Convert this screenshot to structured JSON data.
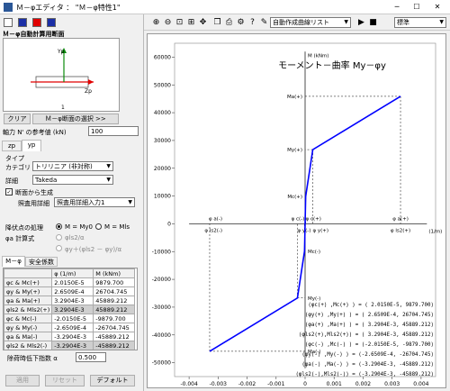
{
  "window": {
    "title": "Ｍ－φエディタ ： \"Ｍ－φ特性1\"",
    "minimize": "─",
    "maximize": "☐",
    "close": "✕"
  },
  "left": {
    "section_title": "Ｍ－φ自動計算用断面",
    "preview": {
      "axis_y": "Yp",
      "axis_z": "Zp",
      "index": "1"
    },
    "clear_button": "クリア",
    "select_section_button": "Ｍ－φ断面の選択 >>",
    "axial_label": "軸力 N' の参考値 (kN)",
    "axial_value": "100",
    "tabs": [
      "zp",
      "yp"
    ],
    "type_label": "タイプ",
    "category_label": "カテゴリ",
    "category_value": "トリリニア (非対称)",
    "detail_label": "詳細",
    "detail_value": "Takeda",
    "generate_label": "断面から生成",
    "checked": "✓",
    "reinforce_label": "照査用詳細",
    "reinforce_value": "照査用詳細入力1",
    "dropping_label": "降伏点の処理",
    "radio1": "M = My0",
    "radio2": "M = Mls",
    "phi_a_label": "φa 計算式",
    "formula1": "φls2/α",
    "formula2": "φy＋(φls2 － φy)/α",
    "table_tabs": [
      "M－φ",
      "安全係数"
    ],
    "table": {
      "headers": [
        "",
        "φ (1/m)",
        "M (kNm)"
      ],
      "rows": [
        [
          "φc & Mc(+)",
          "2.0150E-5",
          "9879.700"
        ],
        [
          "φy & My(+)",
          "2.6509E-4",
          "26704.745"
        ],
        [
          "φa & Ma(+)",
          "3.2904E-3",
          "45889.212"
        ],
        [
          "φls2 & Mls2(+)",
          "3.2904E-3",
          "45889.212"
        ],
        [
          "φc & Mc(-)",
          "-2.0150E-5",
          "-9879.700"
        ],
        [
          "φy & My(-)",
          "-2.6509E-4",
          "-26704.745"
        ],
        [
          "φa & Ma(-)",
          "-3.2904E-3",
          "-45889.212"
        ],
        [
          "φls2 & Mls2(-)",
          "-3.2904E-3",
          "-45889.212"
        ]
      ]
    },
    "degrade_label": "除荷時低下指数 α",
    "degrade_value": "0.500",
    "apply_button": "適用",
    "reset_button": "リセット",
    "default_button": "デフォルト"
  },
  "toolbar": {
    "icons": [
      "zoom-in",
      "zoom-out",
      "zoom-window",
      "zoom-all",
      "pan",
      "copy",
      "print",
      "settings",
      "help",
      "lamp"
    ],
    "auto_list": "自動作成曲線リスト",
    "style_value": "標準",
    "play": "▶",
    "stop": "■"
  },
  "chart_data": {
    "type": "line",
    "title": "モーメント－曲率 My－φy",
    "xlabel": "φ (1/m)",
    "ylabel": "M (kNm)",
    "xlim": [
      -0.0045,
      0.0045
    ],
    "ylim": [
      -55000,
      65000
    ],
    "xticks": [
      "-0.004",
      "-0.003",
      "-0.002",
      "-0.001",
      "0",
      "0.001",
      "0.002",
      "0.003",
      "0.004"
    ],
    "yticks": [
      "-50000",
      "-40000",
      "-30000",
      "-20000",
      "-10000",
      "0",
      "10000",
      "20000",
      "30000",
      "40000",
      "50000",
      "60000"
    ],
    "series": [
      {
        "x": [
          -0.0032904,
          -0.00026509,
          -2.015e-05,
          0,
          2.015e-05,
          0.00026509,
          0.0032904
        ],
        "y": [
          -45889.212,
          -26704.745,
          -9879.7,
          0,
          9879.7,
          26704.745,
          45889.212
        ],
        "color": "#0000ff"
      }
    ],
    "point_labels": [
      {
        "t": "Ma(+)",
        "y": 45889.212
      },
      {
        "t": "My(+)",
        "y": 26704.745
      },
      {
        "t": "Mc(+)",
        "y": 9879.7
      },
      {
        "t": "Mc(-)",
        "y": -9879.7
      },
      {
        "t": "My(-)",
        "y": -26704.745
      },
      {
        "t": "Ma(-)",
        "y": -45889.212
      }
    ],
    "axis_labels_x": [
      "φ a(-)",
      "φ ls2(-)",
      "φ c(-)",
      "φ y(-)",
      "φ c(+)",
      "φ y(+)",
      "φ a(+)",
      "φ ls2(+)"
    ],
    "axis_unit": "(1/m)",
    "axis_m": "M (kNm)",
    "legend_lines": [
      "(φc(+) ,Mc(+)   ) = ( 2.0150E-5,      9879.700)",
      "(φy(+) ,My(+)   ) = ( 2.6509E-4,    26704.745)",
      "(φa(+) ,Ma(+)   ) = ( 3.2904E-3,    45889.212)",
      "(φls2(+),Mls2(+)) = ( 3.2904E-3,    45889.212)",
      "(φc(-) ,Mc(-)   ) = (-2.0150E-5,    -9879.700)",
      "(φy(-) ,My(-)   ) = (-2.6509E-4,  -26704.745)",
      "(φa(-) ,Ma(-)   ) = (-3.2904E-3,  -45889.212)",
      "(φls2(-),Mls2(-)) = (-3.2904E-3,  -45889.212)"
    ]
  }
}
